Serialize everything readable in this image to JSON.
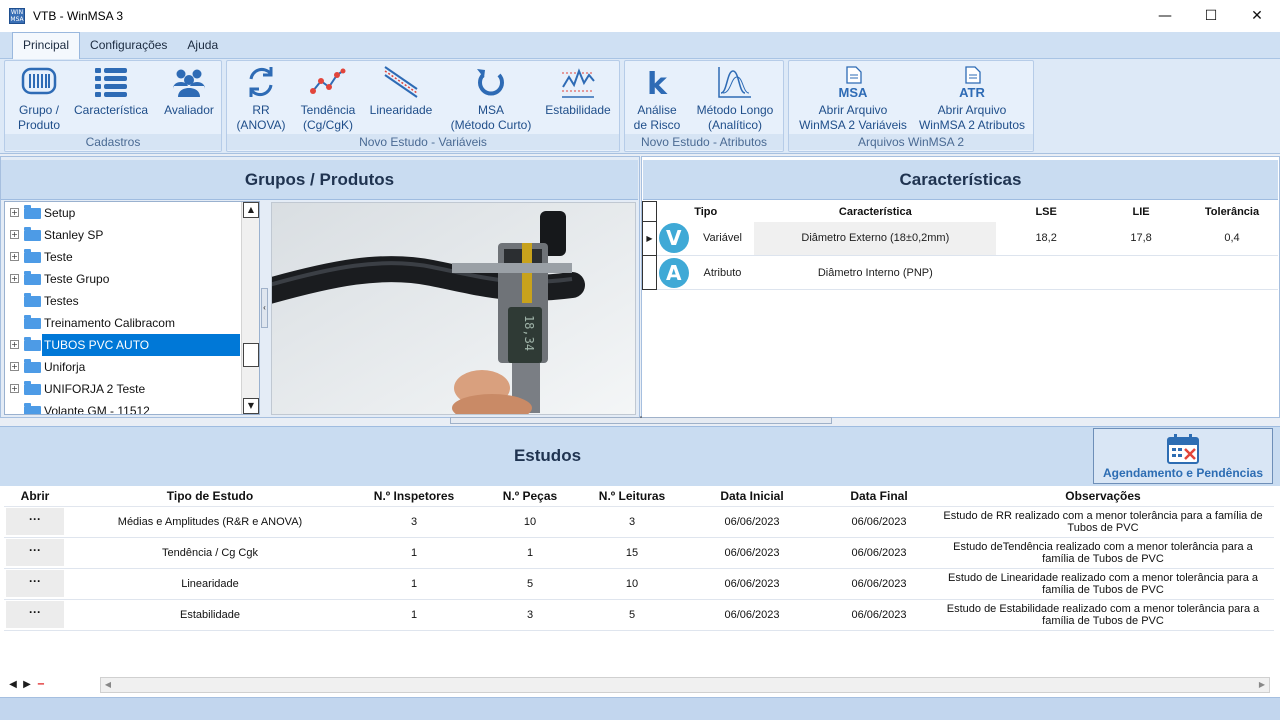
{
  "window": {
    "app_icon_text": "WIN MSA",
    "title": "VTB - WinMSA 3",
    "min_icon": "minimize-icon",
    "max_icon": "maximize-icon",
    "close_icon": "close-icon"
  },
  "menu": {
    "tabs": [
      "Principal",
      "Configurações",
      "Ajuda"
    ],
    "active": "Principal"
  },
  "ribbon": {
    "groups": [
      {
        "label": "Cadastros",
        "buttons": [
          {
            "label1": "Grupo /",
            "label2": "Produto",
            "icon": "barcode-icon"
          },
          {
            "label1": "Característica",
            "label2": "",
            "icon": "list-icon"
          },
          {
            "label1": "Avaliador",
            "label2": "",
            "icon": "users-icon"
          }
        ]
      },
      {
        "label": "Novo Estudo - Variáveis",
        "buttons": [
          {
            "label1": "RR",
            "label2": "(ANOVA)",
            "icon": "refresh-icon"
          },
          {
            "label1": "Tendência",
            "label2": "(Cg/CgK)",
            "icon": "trend-icon"
          },
          {
            "label1": "Linearidade",
            "label2": "",
            "icon": "linearity-icon"
          },
          {
            "label1": "MSA",
            "label2": "(Método Curto)",
            "icon": "undo-arrow-icon"
          },
          {
            "label1": "Estabilidade",
            "label2": "",
            "icon": "stability-chart-icon"
          }
        ]
      },
      {
        "label": "Novo Estudo - Atributos",
        "buttons": [
          {
            "label1": "Análise",
            "label2": "de Risco",
            "icon": "kappa-icon"
          },
          {
            "label1": "Método Longo",
            "label2": "(Analítico)",
            "icon": "wave-chart-icon"
          }
        ]
      },
      {
        "label": "Arquivos WinMSA 2",
        "buttons": [
          {
            "label1": "Abrir Arquivo",
            "label2": "WinMSA 2 Variáveis",
            "icon": "msa-file-icon",
            "badge": "MSA"
          },
          {
            "label1": "Abrir Arquivo",
            "label2": "WinMSA 2 Atributos",
            "icon": "atr-file-icon",
            "badge": "ATR"
          }
        ]
      }
    ]
  },
  "groups_panel": {
    "title": "Grupos / Produtos",
    "items": [
      {
        "label": "Setup",
        "expandable": true
      },
      {
        "label": "Stanley SP",
        "expandable": true
      },
      {
        "label": "Teste",
        "expandable": true
      },
      {
        "label": "Teste Grupo",
        "expandable": true
      },
      {
        "label": "Testes",
        "expandable": false
      },
      {
        "label": "Treinamento Calibracom",
        "expandable": false
      },
      {
        "label": "TUBOS PVC AUTO",
        "expandable": true,
        "selected": true
      },
      {
        "label": "Uniforja",
        "expandable": true
      },
      {
        "label": "UNIFORJA 2 Teste",
        "expandable": true
      },
      {
        "label": "Volante GM - 11512",
        "expandable": false
      }
    ],
    "photo_display": "18,34"
  },
  "characteristics_panel": {
    "title": "Características",
    "columns": [
      "Tipo",
      "Característica",
      "LSE",
      "LIE",
      "Tolerância"
    ],
    "rows": [
      {
        "badge": "V",
        "tipo": "Variável",
        "caracteristica": "Diâmetro Externo (18±0,2mm)",
        "lse": "18,2",
        "lie": "17,8",
        "tolerancia": "0,4"
      },
      {
        "badge": "A",
        "tipo": "Atributo",
        "caracteristica": "Diâmetro Interno (PNP)",
        "lse": "",
        "lie": "",
        "tolerancia": ""
      }
    ]
  },
  "studies_panel": {
    "title": "Estudos",
    "agenda_label": "Agendamento e Pendências",
    "columns": [
      "Abrir",
      "Tipo de Estudo",
      "N.º Inspetores",
      "N.º Peças",
      "N.º Leituras",
      "Data Inicial",
      "Data Final",
      "Observações"
    ],
    "rows": [
      {
        "abrir": "···",
        "tipo": "Médias e Amplitudes (R&R e ANOVA)",
        "inspetores": "3",
        "pecas": "10",
        "leituras": "3",
        "inicio": "06/06/2023",
        "fim": "06/06/2023",
        "obs": "Estudo de RR realizado com a menor tolerância para a família de Tubos de PVC"
      },
      {
        "abrir": "···",
        "tipo": "Tendência / Cg Cgk",
        "inspetores": "1",
        "pecas": "1",
        "leituras": "15",
        "inicio": "06/06/2023",
        "fim": "06/06/2023",
        "obs": "Estudo deTendência realizado com a menor tolerância para a família de Tubos de PVC"
      },
      {
        "abrir": "···",
        "tipo": "Linearidade",
        "inspetores": "1",
        "pecas": "5",
        "leituras": "10",
        "inicio": "06/06/2023",
        "fim": "06/06/2023",
        "obs": "Estudo de Linearidade realizado com a menor tolerância para a família de Tubos de PVC"
      },
      {
        "abrir": "···",
        "tipo": "Estabilidade",
        "inspetores": "1",
        "pecas": "3",
        "leituras": "5",
        "inicio": "06/06/2023",
        "fim": "06/06/2023",
        "obs": "Estudo de Estabilidade realizado com a menor tolerância para a família de Tubos de PVC"
      }
    ]
  },
  "colors": {
    "accent": "#1f4e8a",
    "selection": "#0078d7",
    "badge": "#3fa9d6"
  }
}
